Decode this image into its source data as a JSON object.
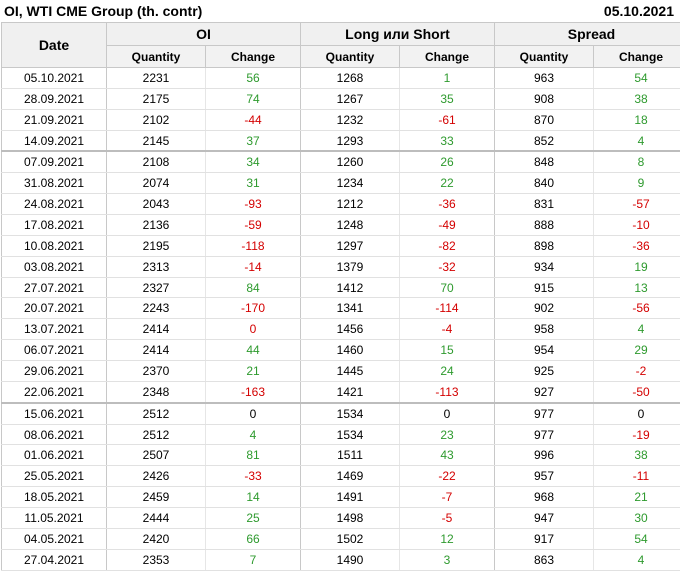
{
  "header": {
    "title": "OI, WTI CME Group (th. contr)",
    "date": "05.10.2021"
  },
  "columns": {
    "date": "Date",
    "groups": [
      "OI",
      "Long или Short",
      "Spread"
    ],
    "quantity": "Quantity",
    "change": "Change"
  },
  "separator_after_rows": [
    3,
    15
  ],
  "rows": [
    {
      "date": "05.10.2021",
      "oi_q": "2231",
      "oi_c": "56",
      "ls_q": "1268",
      "ls_c": "1",
      "sp_q": "963",
      "sp_c": "54"
    },
    {
      "date": "28.09.2021",
      "oi_q": "2175",
      "oi_c": "74",
      "ls_q": "1267",
      "ls_c": "35",
      "sp_q": "908",
      "sp_c": "38"
    },
    {
      "date": "21.09.2021",
      "oi_q": "2102",
      "oi_c": "-44",
      "ls_q": "1232",
      "ls_c": "-61",
      "sp_q": "870",
      "sp_c": "18"
    },
    {
      "date": "14.09.2021",
      "oi_q": "2145",
      "oi_c": "37",
      "ls_q": "1293",
      "ls_c": "33",
      "sp_q": "852",
      "sp_c": "4"
    },
    {
      "date": "07.09.2021",
      "oi_q": "2108",
      "oi_c": "34",
      "ls_q": "1260",
      "ls_c": "26",
      "sp_q": "848",
      "sp_c": "8"
    },
    {
      "date": "31.08.2021",
      "oi_q": "2074",
      "oi_c": "31",
      "ls_q": "1234",
      "ls_c": "22",
      "sp_q": "840",
      "sp_c": "9"
    },
    {
      "date": "24.08.2021",
      "oi_q": "2043",
      "oi_c": "-93",
      "ls_q": "1212",
      "ls_c": "-36",
      "sp_q": "831",
      "sp_c": "-57"
    },
    {
      "date": "17.08.2021",
      "oi_q": "2136",
      "oi_c": "-59",
      "ls_q": "1248",
      "ls_c": "-49",
      "sp_q": "888",
      "sp_c": "-10"
    },
    {
      "date": "10.08.2021",
      "oi_q": "2195",
      "oi_c": "-118",
      "ls_q": "1297",
      "ls_c": "-82",
      "sp_q": "898",
      "sp_c": "-36"
    },
    {
      "date": "03.08.2021",
      "oi_q": "2313",
      "oi_c": "-14",
      "ls_q": "1379",
      "ls_c": "-32",
      "sp_q": "934",
      "sp_c": "19"
    },
    {
      "date": "27.07.2021",
      "oi_q": "2327",
      "oi_c": "84",
      "ls_q": "1412",
      "ls_c": "70",
      "sp_q": "915",
      "sp_c": "13"
    },
    {
      "date": "20.07.2021",
      "oi_q": "2243",
      "oi_c": "-170",
      "ls_q": "1341",
      "ls_c": "-114",
      "sp_q": "902",
      "sp_c": "-56"
    },
    {
      "date": "13.07.2021",
      "oi_q": "2414",
      "oi_c": "0",
      "oi_c_red": true,
      "ls_q": "1456",
      "ls_c": "-4",
      "sp_q": "958",
      "sp_c": "4"
    },
    {
      "date": "06.07.2021",
      "oi_q": "2414",
      "oi_c": "44",
      "ls_q": "1460",
      "ls_c": "15",
      "sp_q": "954",
      "sp_c": "29"
    },
    {
      "date": "29.06.2021",
      "oi_q": "2370",
      "oi_c": "21",
      "ls_q": "1445",
      "ls_c": "24",
      "sp_q": "925",
      "sp_c": "-2"
    },
    {
      "date": "22.06.2021",
      "oi_q": "2348",
      "oi_c": "-163",
      "ls_q": "1421",
      "ls_c": "-113",
      "sp_q": "927",
      "sp_c": "-50"
    },
    {
      "date": "15.06.2021",
      "oi_q": "2512",
      "oi_c": "0",
      "ls_q": "1534",
      "ls_c": "0",
      "sp_q": "977",
      "sp_c": "0"
    },
    {
      "date": "08.06.2021",
      "oi_q": "2512",
      "oi_c": "4",
      "ls_q": "1534",
      "ls_c": "23",
      "sp_q": "977",
      "sp_c": "-19"
    },
    {
      "date": "01.06.2021",
      "oi_q": "2507",
      "oi_c": "81",
      "ls_q": "1511",
      "ls_c": "43",
      "sp_q": "996",
      "sp_c": "38"
    },
    {
      "date": "25.05.2021",
      "oi_q": "2426",
      "oi_c": "-33",
      "ls_q": "1469",
      "ls_c": "-22",
      "sp_q": "957",
      "sp_c": "-11"
    },
    {
      "date": "18.05.2021",
      "oi_q": "2459",
      "oi_c": "14",
      "ls_q": "1491",
      "ls_c": "-7",
      "sp_q": "968",
      "sp_c": "21"
    },
    {
      "date": "11.05.2021",
      "oi_q": "2444",
      "oi_c": "25",
      "ls_q": "1498",
      "ls_c": "-5",
      "sp_q": "947",
      "sp_c": "30"
    },
    {
      "date": "04.05.2021",
      "oi_q": "2420",
      "oi_c": "66",
      "ls_q": "1502",
      "ls_c": "12",
      "sp_q": "917",
      "sp_c": "54"
    },
    {
      "date": "27.04.2021",
      "oi_q": "2353",
      "oi_c": "7",
      "ls_q": "1490",
      "ls_c": "3",
      "sp_q": "863",
      "sp_c": "4"
    }
  ],
  "colors": {
    "positive": "#2e9a2e",
    "negative": "#d40000",
    "header_bg": "#f0f0f0"
  }
}
